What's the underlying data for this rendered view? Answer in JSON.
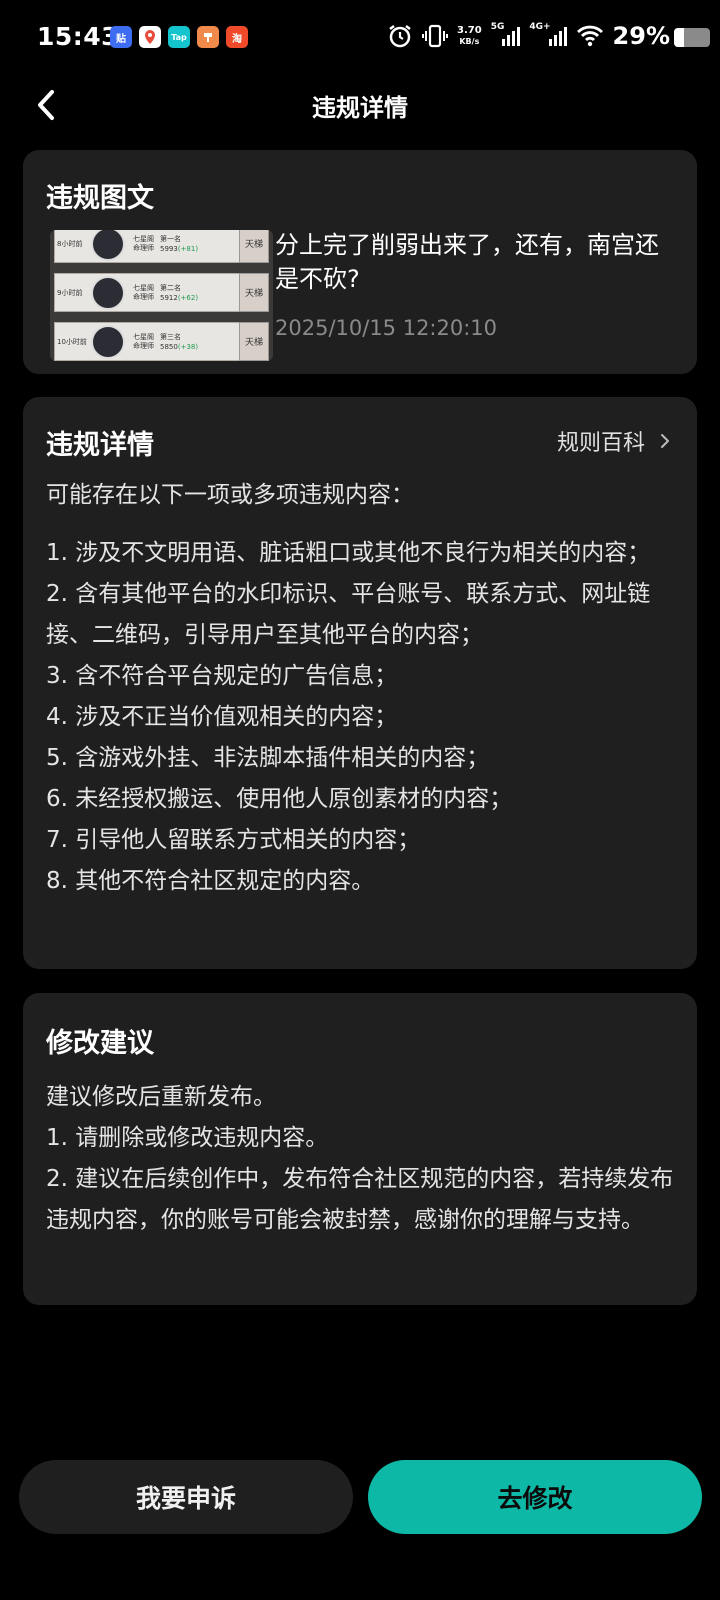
{
  "status_bar": {
    "time": "15:43",
    "app_icons": [
      {
        "icon": "tieba-icon",
        "text": "贴",
        "color": "#3d6cf0"
      },
      {
        "icon": "map-pin-icon",
        "text": "",
        "color": "#e84b3a"
      },
      {
        "icon": "taptap-icon",
        "text": "Tap",
        "color": "#15c5ce"
      },
      {
        "icon": "orange-app-icon",
        "text": "",
        "color": "#f08a4b"
      },
      {
        "icon": "taobao-icon",
        "text": "淘",
        "color": "#f04a2b"
      }
    ],
    "net_speed_value": "3.70",
    "net_speed_unit": "KB/s",
    "signal1_label": "5G",
    "signal2_label": "4G+",
    "battery_percent": "29%"
  },
  "header": {
    "title": "违规详情"
  },
  "post_card": {
    "title": "违规图文",
    "post_text": "分上完了削弱出来了，还有，南宫还是不砍?",
    "post_time": "2025/10/15 12:20:10",
    "thumbnail_rows": [
      {
        "time": "8小时前",
        "name": "七星阁\n命理师",
        "rank": "第一名",
        "score": "5993",
        "delta": "(+81)",
        "tag": "天梯"
      },
      {
        "time": "9小时前",
        "name": "七星阁\n命理师",
        "rank": "第二名",
        "score": "5912",
        "delta": "(+62)",
        "tag": "天梯"
      },
      {
        "time": "10小时前",
        "name": "七星阁\n命理师",
        "rank": "第三名",
        "score": "5850",
        "delta": "(+38)",
        "tag": "天梯"
      }
    ]
  },
  "details_card": {
    "title": "违规详情",
    "rules_link": "规则百科",
    "intro": "可能存在以下一项或多项违规内容：",
    "items": [
      "1. 涉及不文明用语、脏话粗口或其他不良行为相关的内容；",
      "2. 含有其他平台的水印标识、平台账号、联系方式、网址链接、二维码，引导用户至其他平台的内容；",
      "3. 含不符合平台规定的广告信息；",
      "4. 涉及不正当价值观相关的内容；",
      "5. 含游戏外挂、非法脚本插件相关的内容；",
      "6. 未经授权搬运、使用他人原创素材的内容；",
      "7. 引导他人留联系方式相关的内容；",
      "8. 其他不符合社区规定的内容。"
    ]
  },
  "suggestion_card": {
    "title": "修改建议",
    "lines": [
      "建议修改后重新发布。",
      "1. 请删除或修改违规内容。",
      "2. 建议在后续创作中，发布符合社区规范的内容，若持续发布违规内容，你的账号可能会被封禁，感谢你的理解与支持。"
    ]
  },
  "buttons": {
    "appeal": "我要申诉",
    "edit": "去修改"
  },
  "colors": {
    "background": "#000000",
    "card": "#1f1f1f",
    "accent": "#0db9a6"
  }
}
